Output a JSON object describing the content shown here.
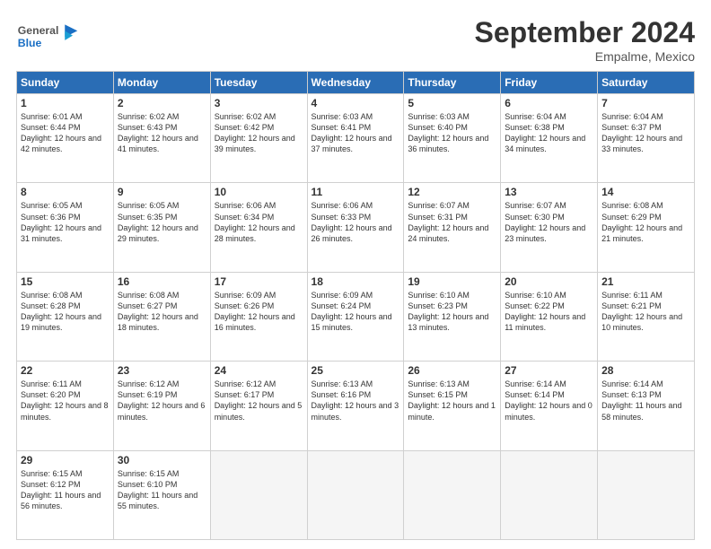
{
  "header": {
    "logo_general": "General",
    "logo_blue": "Blue",
    "month_title": "September 2024",
    "subtitle": "Empalme, Mexico"
  },
  "weekdays": [
    "Sunday",
    "Monday",
    "Tuesday",
    "Wednesday",
    "Thursday",
    "Friday",
    "Saturday"
  ],
  "weeks": [
    [
      {
        "day": "1",
        "sunrise": "Sunrise: 6:01 AM",
        "sunset": "Sunset: 6:44 PM",
        "daylight": "Daylight: 12 hours and 42 minutes."
      },
      {
        "day": "2",
        "sunrise": "Sunrise: 6:02 AM",
        "sunset": "Sunset: 6:43 PM",
        "daylight": "Daylight: 12 hours and 41 minutes."
      },
      {
        "day": "3",
        "sunrise": "Sunrise: 6:02 AM",
        "sunset": "Sunset: 6:42 PM",
        "daylight": "Daylight: 12 hours and 39 minutes."
      },
      {
        "day": "4",
        "sunrise": "Sunrise: 6:03 AM",
        "sunset": "Sunset: 6:41 PM",
        "daylight": "Daylight: 12 hours and 37 minutes."
      },
      {
        "day": "5",
        "sunrise": "Sunrise: 6:03 AM",
        "sunset": "Sunset: 6:40 PM",
        "daylight": "Daylight: 12 hours and 36 minutes."
      },
      {
        "day": "6",
        "sunrise": "Sunrise: 6:04 AM",
        "sunset": "Sunset: 6:38 PM",
        "daylight": "Daylight: 12 hours and 34 minutes."
      },
      {
        "day": "7",
        "sunrise": "Sunrise: 6:04 AM",
        "sunset": "Sunset: 6:37 PM",
        "daylight": "Daylight: 12 hours and 33 minutes."
      }
    ],
    [
      {
        "day": "8",
        "sunrise": "Sunrise: 6:05 AM",
        "sunset": "Sunset: 6:36 PM",
        "daylight": "Daylight: 12 hours and 31 minutes."
      },
      {
        "day": "9",
        "sunrise": "Sunrise: 6:05 AM",
        "sunset": "Sunset: 6:35 PM",
        "daylight": "Daylight: 12 hours and 29 minutes."
      },
      {
        "day": "10",
        "sunrise": "Sunrise: 6:06 AM",
        "sunset": "Sunset: 6:34 PM",
        "daylight": "Daylight: 12 hours and 28 minutes."
      },
      {
        "day": "11",
        "sunrise": "Sunrise: 6:06 AM",
        "sunset": "Sunset: 6:33 PM",
        "daylight": "Daylight: 12 hours and 26 minutes."
      },
      {
        "day": "12",
        "sunrise": "Sunrise: 6:07 AM",
        "sunset": "Sunset: 6:31 PM",
        "daylight": "Daylight: 12 hours and 24 minutes."
      },
      {
        "day": "13",
        "sunrise": "Sunrise: 6:07 AM",
        "sunset": "Sunset: 6:30 PM",
        "daylight": "Daylight: 12 hours and 23 minutes."
      },
      {
        "day": "14",
        "sunrise": "Sunrise: 6:08 AM",
        "sunset": "Sunset: 6:29 PM",
        "daylight": "Daylight: 12 hours and 21 minutes."
      }
    ],
    [
      {
        "day": "15",
        "sunrise": "Sunrise: 6:08 AM",
        "sunset": "Sunset: 6:28 PM",
        "daylight": "Daylight: 12 hours and 19 minutes."
      },
      {
        "day": "16",
        "sunrise": "Sunrise: 6:08 AM",
        "sunset": "Sunset: 6:27 PM",
        "daylight": "Daylight: 12 hours and 18 minutes."
      },
      {
        "day": "17",
        "sunrise": "Sunrise: 6:09 AM",
        "sunset": "Sunset: 6:26 PM",
        "daylight": "Daylight: 12 hours and 16 minutes."
      },
      {
        "day": "18",
        "sunrise": "Sunrise: 6:09 AM",
        "sunset": "Sunset: 6:24 PM",
        "daylight": "Daylight: 12 hours and 15 minutes."
      },
      {
        "day": "19",
        "sunrise": "Sunrise: 6:10 AM",
        "sunset": "Sunset: 6:23 PM",
        "daylight": "Daylight: 12 hours and 13 minutes."
      },
      {
        "day": "20",
        "sunrise": "Sunrise: 6:10 AM",
        "sunset": "Sunset: 6:22 PM",
        "daylight": "Daylight: 12 hours and 11 minutes."
      },
      {
        "day": "21",
        "sunrise": "Sunrise: 6:11 AM",
        "sunset": "Sunset: 6:21 PM",
        "daylight": "Daylight: 12 hours and 10 minutes."
      }
    ],
    [
      {
        "day": "22",
        "sunrise": "Sunrise: 6:11 AM",
        "sunset": "Sunset: 6:20 PM",
        "daylight": "Daylight: 12 hours and 8 minutes."
      },
      {
        "day": "23",
        "sunrise": "Sunrise: 6:12 AM",
        "sunset": "Sunset: 6:19 PM",
        "daylight": "Daylight: 12 hours and 6 minutes."
      },
      {
        "day": "24",
        "sunrise": "Sunrise: 6:12 AM",
        "sunset": "Sunset: 6:17 PM",
        "daylight": "Daylight: 12 hours and 5 minutes."
      },
      {
        "day": "25",
        "sunrise": "Sunrise: 6:13 AM",
        "sunset": "Sunset: 6:16 PM",
        "daylight": "Daylight: 12 hours and 3 minutes."
      },
      {
        "day": "26",
        "sunrise": "Sunrise: 6:13 AM",
        "sunset": "Sunset: 6:15 PM",
        "daylight": "Daylight: 12 hours and 1 minute."
      },
      {
        "day": "27",
        "sunrise": "Sunrise: 6:14 AM",
        "sunset": "Sunset: 6:14 PM",
        "daylight": "Daylight: 12 hours and 0 minutes."
      },
      {
        "day": "28",
        "sunrise": "Sunrise: 6:14 AM",
        "sunset": "Sunset: 6:13 PM",
        "daylight": "Daylight: 11 hours and 58 minutes."
      }
    ],
    [
      {
        "day": "29",
        "sunrise": "Sunrise: 6:15 AM",
        "sunset": "Sunset: 6:12 PM",
        "daylight": "Daylight: 11 hours and 56 minutes."
      },
      {
        "day": "30",
        "sunrise": "Sunrise: 6:15 AM",
        "sunset": "Sunset: 6:10 PM",
        "daylight": "Daylight: 11 hours and 55 minutes."
      },
      null,
      null,
      null,
      null,
      null
    ]
  ]
}
